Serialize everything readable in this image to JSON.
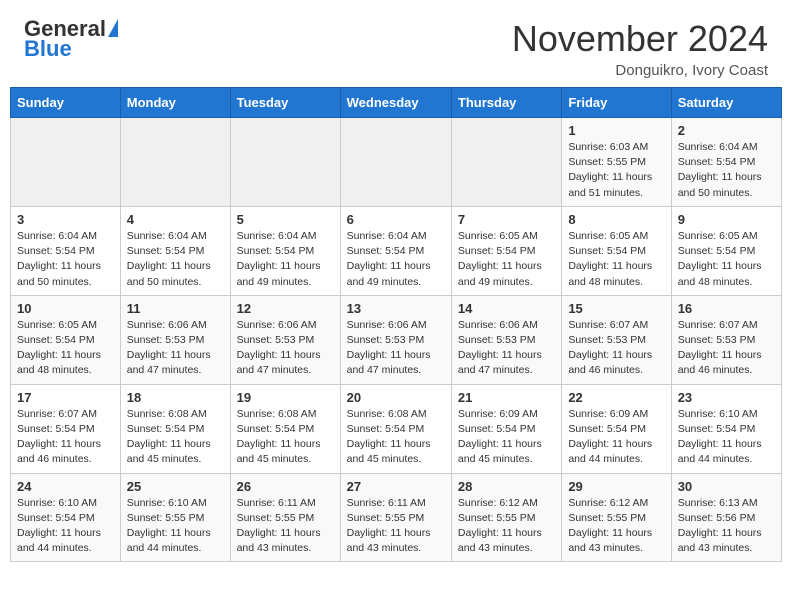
{
  "header": {
    "logo_general": "General",
    "logo_blue": "Blue",
    "month_title": "November 2024",
    "location": "Donguikro, Ivory Coast"
  },
  "calendar": {
    "days_of_week": [
      "Sunday",
      "Monday",
      "Tuesday",
      "Wednesday",
      "Thursday",
      "Friday",
      "Saturday"
    ],
    "weeks": [
      [
        {
          "day": "",
          "info": ""
        },
        {
          "day": "",
          "info": ""
        },
        {
          "day": "",
          "info": ""
        },
        {
          "day": "",
          "info": ""
        },
        {
          "day": "",
          "info": ""
        },
        {
          "day": "1",
          "info": "Sunrise: 6:03 AM\nSunset: 5:55 PM\nDaylight: 11 hours and 51 minutes."
        },
        {
          "day": "2",
          "info": "Sunrise: 6:04 AM\nSunset: 5:54 PM\nDaylight: 11 hours and 50 minutes."
        }
      ],
      [
        {
          "day": "3",
          "info": "Sunrise: 6:04 AM\nSunset: 5:54 PM\nDaylight: 11 hours and 50 minutes."
        },
        {
          "day": "4",
          "info": "Sunrise: 6:04 AM\nSunset: 5:54 PM\nDaylight: 11 hours and 50 minutes."
        },
        {
          "day": "5",
          "info": "Sunrise: 6:04 AM\nSunset: 5:54 PM\nDaylight: 11 hours and 49 minutes."
        },
        {
          "day": "6",
          "info": "Sunrise: 6:04 AM\nSunset: 5:54 PM\nDaylight: 11 hours and 49 minutes."
        },
        {
          "day": "7",
          "info": "Sunrise: 6:05 AM\nSunset: 5:54 PM\nDaylight: 11 hours and 49 minutes."
        },
        {
          "day": "8",
          "info": "Sunrise: 6:05 AM\nSunset: 5:54 PM\nDaylight: 11 hours and 48 minutes."
        },
        {
          "day": "9",
          "info": "Sunrise: 6:05 AM\nSunset: 5:54 PM\nDaylight: 11 hours and 48 minutes."
        }
      ],
      [
        {
          "day": "10",
          "info": "Sunrise: 6:05 AM\nSunset: 5:54 PM\nDaylight: 11 hours and 48 minutes."
        },
        {
          "day": "11",
          "info": "Sunrise: 6:06 AM\nSunset: 5:53 PM\nDaylight: 11 hours and 47 minutes."
        },
        {
          "day": "12",
          "info": "Sunrise: 6:06 AM\nSunset: 5:53 PM\nDaylight: 11 hours and 47 minutes."
        },
        {
          "day": "13",
          "info": "Sunrise: 6:06 AM\nSunset: 5:53 PM\nDaylight: 11 hours and 47 minutes."
        },
        {
          "day": "14",
          "info": "Sunrise: 6:06 AM\nSunset: 5:53 PM\nDaylight: 11 hours and 47 minutes."
        },
        {
          "day": "15",
          "info": "Sunrise: 6:07 AM\nSunset: 5:53 PM\nDaylight: 11 hours and 46 minutes."
        },
        {
          "day": "16",
          "info": "Sunrise: 6:07 AM\nSunset: 5:53 PM\nDaylight: 11 hours and 46 minutes."
        }
      ],
      [
        {
          "day": "17",
          "info": "Sunrise: 6:07 AM\nSunset: 5:54 PM\nDaylight: 11 hours and 46 minutes."
        },
        {
          "day": "18",
          "info": "Sunrise: 6:08 AM\nSunset: 5:54 PM\nDaylight: 11 hours and 45 minutes."
        },
        {
          "day": "19",
          "info": "Sunrise: 6:08 AM\nSunset: 5:54 PM\nDaylight: 11 hours and 45 minutes."
        },
        {
          "day": "20",
          "info": "Sunrise: 6:08 AM\nSunset: 5:54 PM\nDaylight: 11 hours and 45 minutes."
        },
        {
          "day": "21",
          "info": "Sunrise: 6:09 AM\nSunset: 5:54 PM\nDaylight: 11 hours and 45 minutes."
        },
        {
          "day": "22",
          "info": "Sunrise: 6:09 AM\nSunset: 5:54 PM\nDaylight: 11 hours and 44 minutes."
        },
        {
          "day": "23",
          "info": "Sunrise: 6:10 AM\nSunset: 5:54 PM\nDaylight: 11 hours and 44 minutes."
        }
      ],
      [
        {
          "day": "24",
          "info": "Sunrise: 6:10 AM\nSunset: 5:54 PM\nDaylight: 11 hours and 44 minutes."
        },
        {
          "day": "25",
          "info": "Sunrise: 6:10 AM\nSunset: 5:55 PM\nDaylight: 11 hours and 44 minutes."
        },
        {
          "day": "26",
          "info": "Sunrise: 6:11 AM\nSunset: 5:55 PM\nDaylight: 11 hours and 43 minutes."
        },
        {
          "day": "27",
          "info": "Sunrise: 6:11 AM\nSunset: 5:55 PM\nDaylight: 11 hours and 43 minutes."
        },
        {
          "day": "28",
          "info": "Sunrise: 6:12 AM\nSunset: 5:55 PM\nDaylight: 11 hours and 43 minutes."
        },
        {
          "day": "29",
          "info": "Sunrise: 6:12 AM\nSunset: 5:55 PM\nDaylight: 11 hours and 43 minutes."
        },
        {
          "day": "30",
          "info": "Sunrise: 6:13 AM\nSunset: 5:56 PM\nDaylight: 11 hours and 43 minutes."
        }
      ]
    ]
  }
}
